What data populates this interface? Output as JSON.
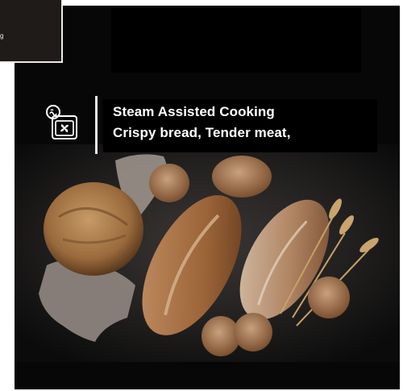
{
  "edge_popup": {
    "label": "g"
  },
  "feature": {
    "icon": "steam-oven-icon",
    "title": "Steam Assisted Cooking",
    "subtitle": "Crispy bread, Tender meat,"
  },
  "colors": {
    "background": "#070708",
    "text": "#ffffff",
    "divider": "#e9e9e9"
  }
}
